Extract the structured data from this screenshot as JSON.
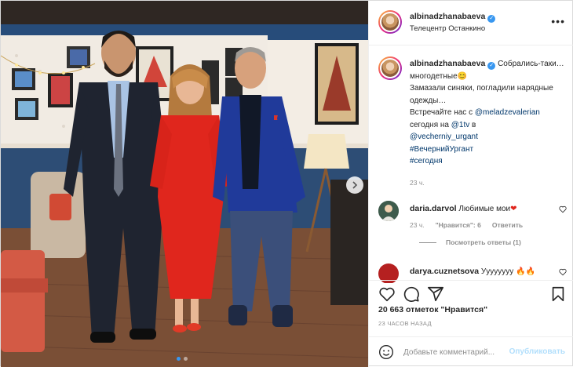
{
  "post": {
    "author": {
      "username": "albinadzhanabaeva",
      "verified": true,
      "location": "Телецентр Останкино"
    },
    "caption": {
      "text_plain_1": "Собрались-таки… многодетные",
      "text_plain_2": "Замазали синяки, погладили нарядные одежды…",
      "text_plain_3": "Встречайте нас с ",
      "mention_1": "@meladzevalerian",
      "text_plain_4": " сегодня на ",
      "mention_2": "@1tv",
      "text_plain_5": " в ",
      "mention_3": "@vecherniy_urgant",
      "hashtag_1": "#ВечернийУргант",
      "hashtag_2": "#сегодня",
      "time": "23 ч."
    },
    "comments": [
      {
        "username": "daria.darvol",
        "text": "Любимые мои",
        "time": "23 ч.",
        "likes": "\"Нравится\": 6",
        "reply": "Ответить",
        "view_replies": "Посмотреть ответы (1)"
      },
      {
        "username": "darya.cuznetsova",
        "text": "Уууууууу"
      }
    ],
    "likes": "20 663 отметок \"Нравится\"",
    "date": "23 ЧАСОВ НАЗАД",
    "add_comment": {
      "placeholder": "Добавьте комментарий...",
      "post_label": "Опубликовать"
    },
    "carousel": {
      "slides": 2,
      "active": 1
    },
    "icons": {
      "more": "more-horizontal-icon",
      "like": "heart-icon",
      "comment": "comment-icon",
      "share": "share-icon",
      "save": "bookmark-icon",
      "emoji": "emoji-icon",
      "next": "chevron-right-icon"
    },
    "colors": {
      "verified": "#3897f0",
      "link": "#00376b",
      "muted": "#8e8e8e",
      "post_button": "#b2dffc"
    }
  }
}
